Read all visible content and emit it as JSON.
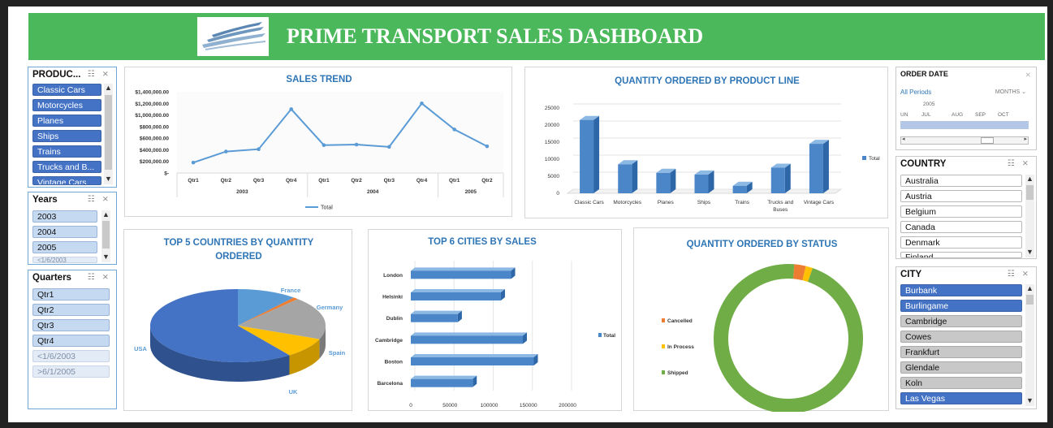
{
  "header": {
    "title": "PRIME TRANSPORT  SALES DASHBOARD"
  },
  "slicers": {
    "product": {
      "title": "PRODUC...",
      "items": [
        "Classic Cars",
        "Motorcycles",
        "Planes",
        "Ships",
        "Trains",
        "Trucks and B...",
        "Vintage Cars"
      ]
    },
    "years": {
      "title": "Years",
      "items": [
        "2003",
        "2004",
        "2005",
        "<1/6/2003"
      ]
    },
    "quarters": {
      "title": "Quarters",
      "items": [
        "Qtr1",
        "Qtr2",
        "Qtr3",
        "Qtr4",
        "<1/6/2003",
        ">6/1/2005"
      ]
    },
    "order_date": {
      "title": "ORDER DATE",
      "periods": "All Periods",
      "unit": "MONTHS",
      "year": "2005",
      "months": [
        "UN",
        "JUL",
        "AUG",
        "SEP",
        "OCT"
      ]
    },
    "country": {
      "title": "COUNTRY",
      "items": [
        "Australia",
        "Austria",
        "Belgium",
        "Canada",
        "Denmark",
        "Finland"
      ]
    },
    "city": {
      "title": "CITY",
      "items": [
        "Burbank",
        "Burlingame",
        "Cambridge",
        "Cowes",
        "Frankfurt",
        "Glendale",
        "Koln",
        "Las Vegas"
      ]
    }
  },
  "colors": {
    "banner": "#4cb85c",
    "accent": "#2e75b6",
    "bar": "#5b9bd5",
    "selected": "#4472c4"
  },
  "chart_data": [
    {
      "type": "line",
      "title": "SALES TREND",
      "categories": [
        "Qtr1",
        "Qtr2",
        "Qtr3",
        "Qtr4",
        "Qtr1",
        "Qtr2",
        "Qtr3",
        "Qtr4",
        "Qtr1",
        "Qtr2"
      ],
      "groups": [
        "2003",
        "2004",
        "2005"
      ],
      "series": [
        {
          "name": "Total",
          "values": [
            180000,
            370000,
            410000,
            1100000,
            480000,
            490000,
            450000,
            1200000,
            750000,
            460000
          ]
        }
      ],
      "yticks": [
        "$1,400,000.00",
        "$1,200,000.00",
        "$1,000,000.00",
        "$800,000.00",
        "$600,000.00",
        "$400,000.00",
        "$200,000.00",
        "$-"
      ],
      "ylim": [
        0,
        1400000
      ],
      "legend": "bottom"
    },
    {
      "type": "bar",
      "title": "QUANTITY ORDERED BY PRODUCT LINE",
      "categories": [
        "Classic Cars",
        "Motorcycles",
        "Planes",
        "Ships",
        "Trains",
        "Trucks and Buses",
        "Vintage Cars"
      ],
      "series": [
        {
          "name": "Total",
          "values": [
            21500,
            8500,
            6000,
            5500,
            2200,
            7500,
            14500
          ]
        }
      ],
      "yticks": [
        "25000",
        "20000",
        "15000",
        "10000",
        "5000",
        "0"
      ],
      "ylim": [
        0,
        25000
      ],
      "legend": "right"
    },
    {
      "type": "pie",
      "title": "TOP 5 COUNTRIES BY QUANTITY ORDERED",
      "labels": [
        "USA",
        "France",
        "Germany",
        "Spain",
        "UK"
      ],
      "values": [
        60,
        11,
        1,
        19,
        9
      ]
    },
    {
      "type": "bar",
      "orientation": "horizontal",
      "title": "TOP 6 CITIES BY SALES",
      "categories": [
        "London",
        "Helsinki",
        "Dublin",
        "Cambridge",
        "Boston",
        "Barcelona"
      ],
      "series": [
        {
          "name": "Total",
          "values": [
            128000,
            115000,
            60000,
            143000,
            157000,
            79000
          ]
        }
      ],
      "xticks": [
        "0",
        "50000",
        "100000",
        "150000",
        "200000"
      ],
      "xlim": [
        0,
        200000
      ],
      "legend": "right"
    },
    {
      "type": "pie",
      "subtype": "doughnut",
      "title": "QUANTITY ORDERED BY STATUS",
      "labels": [
        "Cancelled",
        "In Process",
        "Shipped"
      ],
      "values": [
        2.5,
        1.5,
        96
      ],
      "colors": [
        "#ed7d31",
        "#ffc000",
        "#70ad47"
      ],
      "legend": "left"
    }
  ]
}
